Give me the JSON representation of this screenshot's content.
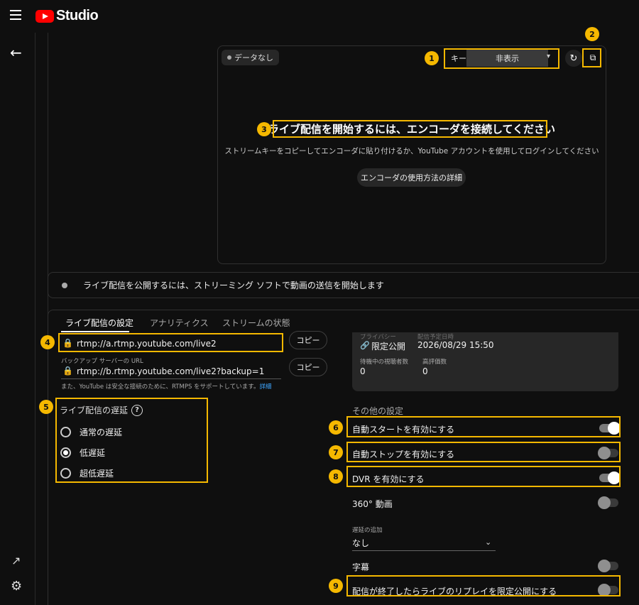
{
  "app": {
    "logo_text": "Studio"
  },
  "preview": {
    "no_data": "データなし",
    "key_label": "キー",
    "key_masked": "非表示",
    "connect_title": "ライブ配信を開始するには、エンコーダを接続してください",
    "connect_sub": "ストリームキーをコピーしてエンコーダに貼り付けるか、YouTube アカウントを使用してログインしてください",
    "howto_button": "エンコーダの使用方法の詳細"
  },
  "banner": {
    "text": "ライブ配信を公開するには、ストリーミング ソフトで動画の送信を開始します"
  },
  "tabs": [
    "ライブ配信の設定",
    "アナリティクス",
    "ストリームの状態"
  ],
  "stream": {
    "url": "rtmp://a.rtmp.youtube.com/live2",
    "backup_label": "バックアップ サーバーの URL",
    "backup_url": "rtmp://b.rtmp.youtube.com/live2?backup=1",
    "copy_label": "コピー",
    "note": "また、YouTube は安全な接続のために、RTMPS をサポートしています。",
    "note_link": "詳細"
  },
  "latency": {
    "title": "ライブ配信の遅延",
    "options": [
      {
        "label": "通常の遅延",
        "selected": false
      },
      {
        "label": "低遅延",
        "selected": true
      },
      {
        "label": "超低遅延",
        "selected": false
      }
    ]
  },
  "info": {
    "visibility_label": "プライバシー",
    "visibility": "限定公開",
    "scheduled_label": "配信予定日時",
    "scheduled": "2026/08/29 15:50",
    "viewers_label": "待機中の視聴者数",
    "viewers": "0",
    "likes_label": "高評価数",
    "likes": "0"
  },
  "other": {
    "title": "その他の設定",
    "toggles": [
      {
        "label": "自動スタートを有効にする",
        "on": true
      },
      {
        "label": "自動ストップを有効にする",
        "on": false
      },
      {
        "label": "DVR を有効にする",
        "on": true
      },
      {
        "label": "360° 動画",
        "on": false
      },
      {
        "label": "字幕",
        "on": false
      },
      {
        "label": "配信が終了したらライブのリプレイを限定公開にする",
        "on": false
      }
    ],
    "delay_label": "遅延の追加",
    "delay_value": "なし"
  },
  "annotations": [
    "1",
    "2",
    "3",
    "4",
    "5",
    "6",
    "7",
    "8",
    "9"
  ],
  "colors": {
    "annotation": "#f5b800",
    "brand_red": "#ff0000",
    "link": "#3ea6ff"
  }
}
